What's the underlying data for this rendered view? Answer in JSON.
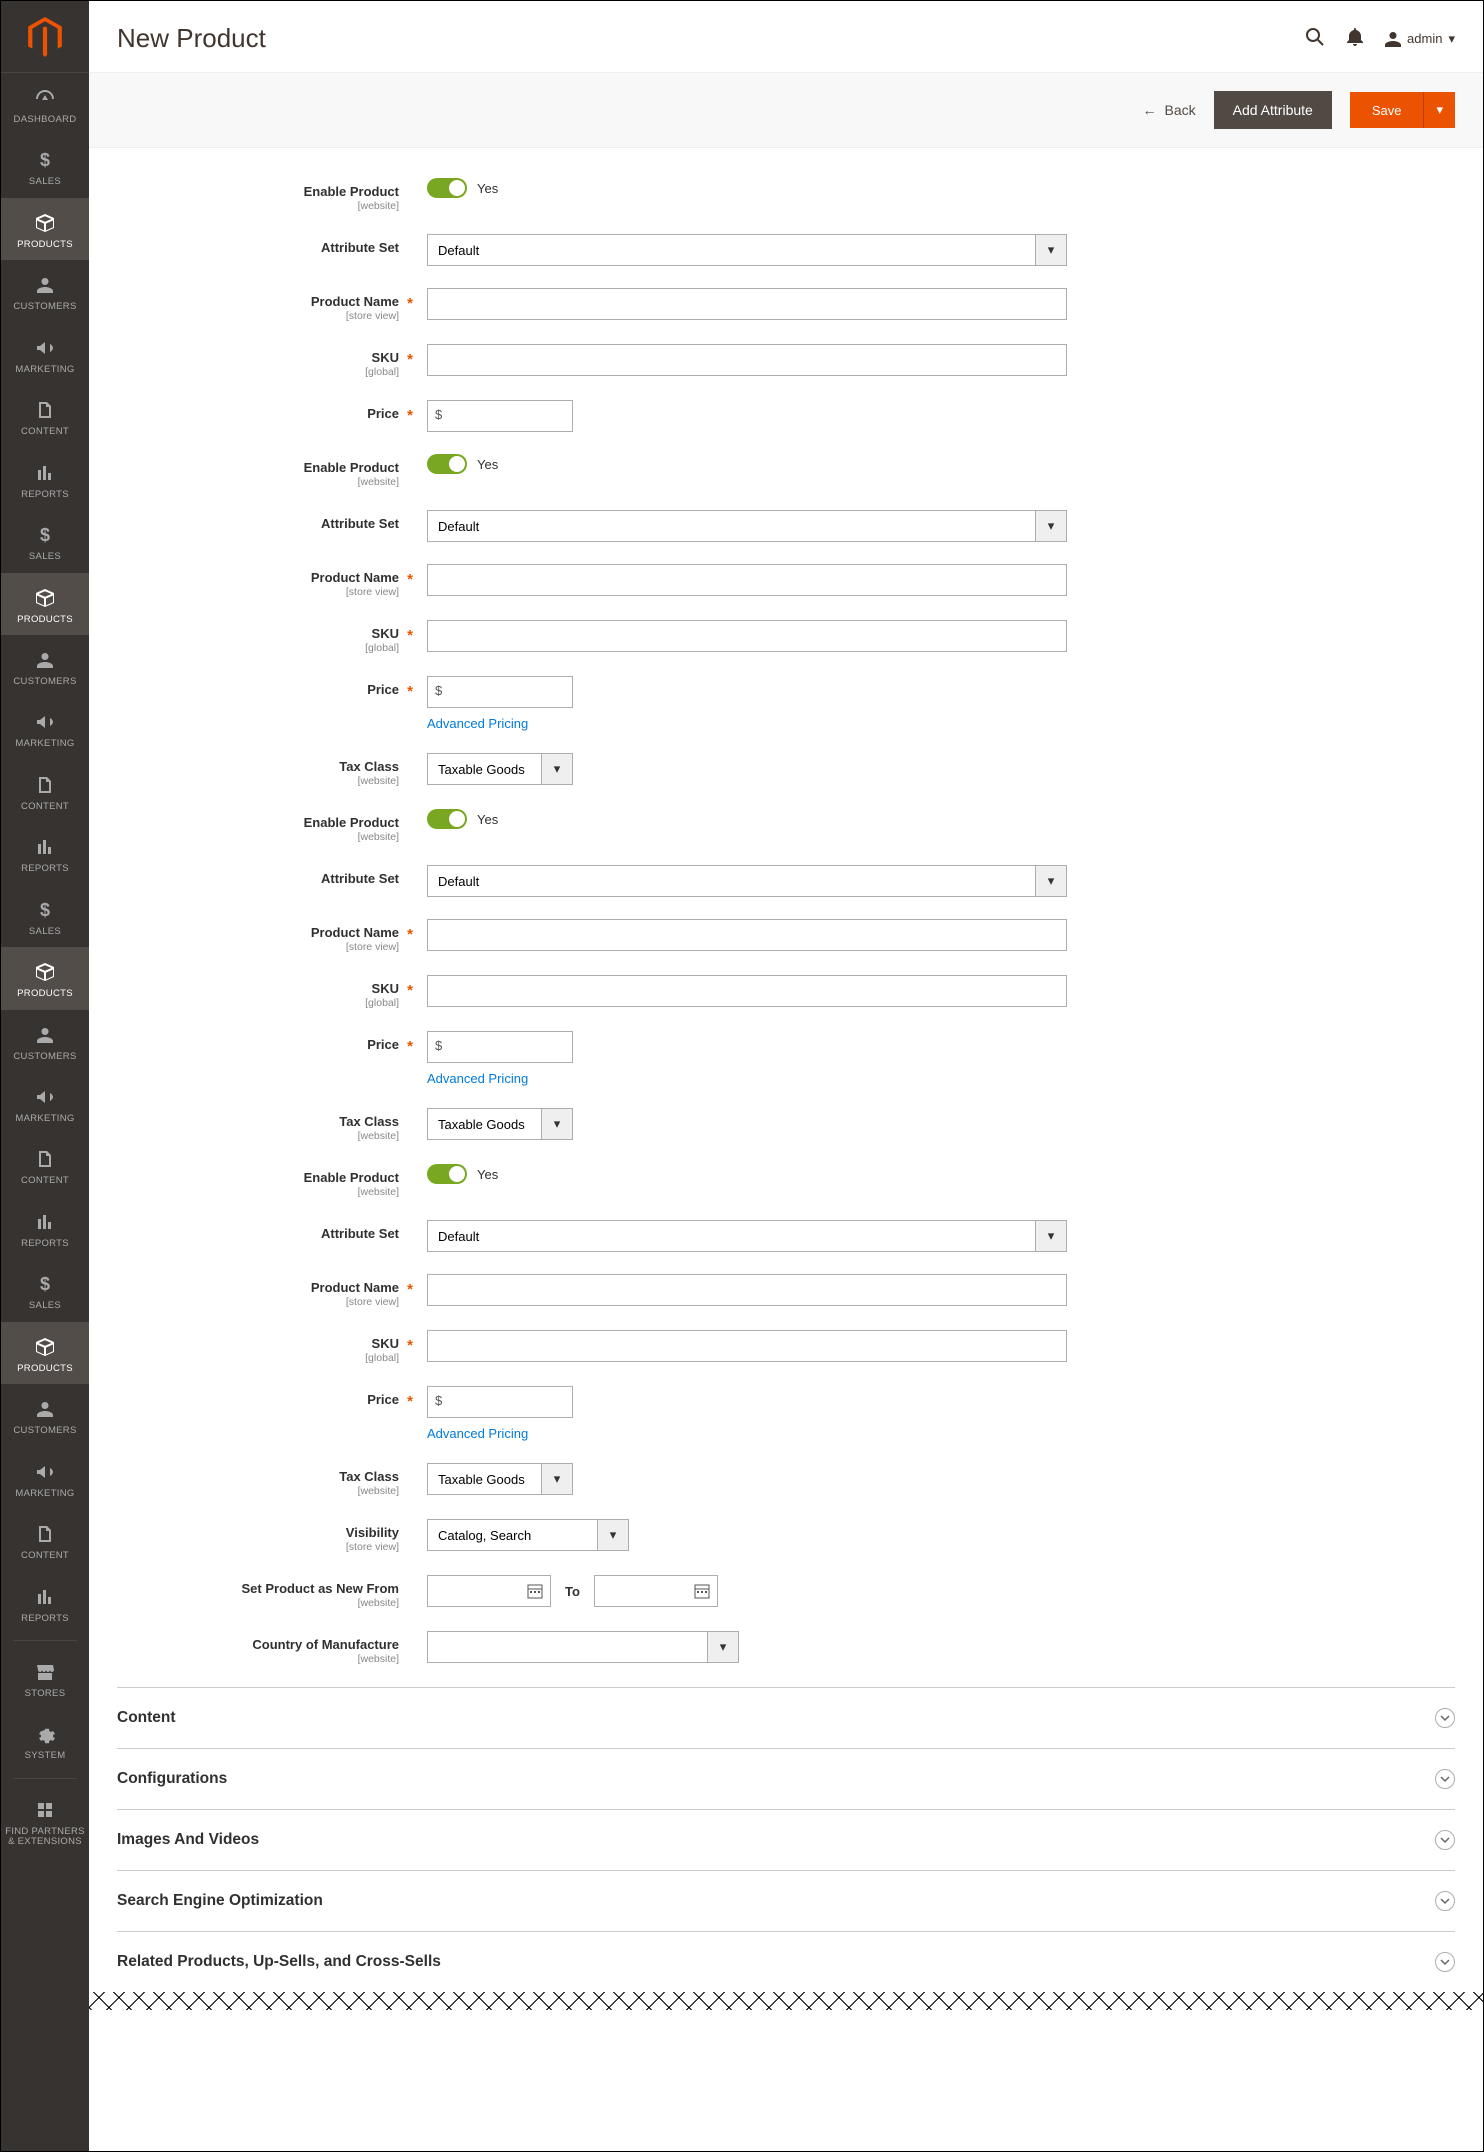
{
  "header": {
    "page_title": "New Product",
    "user_name": "admin",
    "back_label": "Back",
    "add_attribute_label": "Add Attribute",
    "save_label": "Save"
  },
  "sidebar": {
    "items": [
      {
        "label": "DASHBOARD",
        "icon": "gauge"
      },
      {
        "label": "SALES",
        "icon": "dollar"
      },
      {
        "label": "PRODUCTS",
        "icon": "box",
        "active": true
      },
      {
        "label": "CUSTOMERS",
        "icon": "person"
      },
      {
        "label": "MARKETING",
        "icon": "megaphone"
      },
      {
        "label": "CONTENT",
        "icon": "page"
      },
      {
        "label": "REPORTS",
        "icon": "bars"
      },
      {
        "label": "SALES",
        "icon": "dollar"
      },
      {
        "label": "PRODUCTS",
        "icon": "box",
        "active": true
      },
      {
        "label": "CUSTOMERS",
        "icon": "person"
      },
      {
        "label": "MARKETING",
        "icon": "megaphone"
      },
      {
        "label": "CONTENT",
        "icon": "page"
      },
      {
        "label": "REPORTS",
        "icon": "bars"
      },
      {
        "label": "SALES",
        "icon": "dollar"
      },
      {
        "label": "PRODUCTS",
        "icon": "box",
        "active": true
      },
      {
        "label": "CUSTOMERS",
        "icon": "person"
      },
      {
        "label": "MARKETING",
        "icon": "megaphone"
      },
      {
        "label": "CONTENT",
        "icon": "page"
      },
      {
        "label": "REPORTS",
        "icon": "bars"
      },
      {
        "label": "SALES",
        "icon": "dollar"
      },
      {
        "label": "PRODUCTS",
        "icon": "box",
        "active": true
      },
      {
        "label": "CUSTOMERS",
        "icon": "person"
      },
      {
        "label": "MARKETING",
        "icon": "megaphone"
      },
      {
        "label": "CONTENT",
        "icon": "page"
      },
      {
        "label": "REPORTS",
        "icon": "bars"
      },
      {
        "label": "STORES",
        "icon": "store"
      },
      {
        "label": "SYSTEM",
        "icon": "gear"
      },
      {
        "label": "FIND PARTNERS & EXTENSIONS",
        "icon": "partners"
      }
    ]
  },
  "form": {
    "enable_product": {
      "label": "Enable Product",
      "scope": "[website]",
      "value": "Yes"
    },
    "attribute_set": {
      "label": "Attribute Set",
      "value": "Default"
    },
    "product_name": {
      "label": "Product Name",
      "scope": "[store view]"
    },
    "sku": {
      "label": "SKU",
      "scope": "[global]"
    },
    "price": {
      "label": "Price",
      "currency": "$"
    },
    "advanced_pricing": "Advanced Pricing",
    "tax_class": {
      "label": "Tax Class",
      "scope": "[website]",
      "value": "Taxable Goods"
    },
    "visibility": {
      "label": "Visibility",
      "scope": "[store view]",
      "value": "Catalog, Search"
    },
    "set_new": {
      "label": "Set Product as New From",
      "scope": "[website]",
      "to_label": "To"
    },
    "country": {
      "label": "Country of Manufacture",
      "scope": "[website]"
    }
  },
  "sections": [
    {
      "title": "Content"
    },
    {
      "title": "Configurations"
    },
    {
      "title": "Images And Videos"
    },
    {
      "title": "Search Engine Optimization"
    },
    {
      "title": "Related Products, Up-Sells, and Cross-Sells"
    }
  ]
}
